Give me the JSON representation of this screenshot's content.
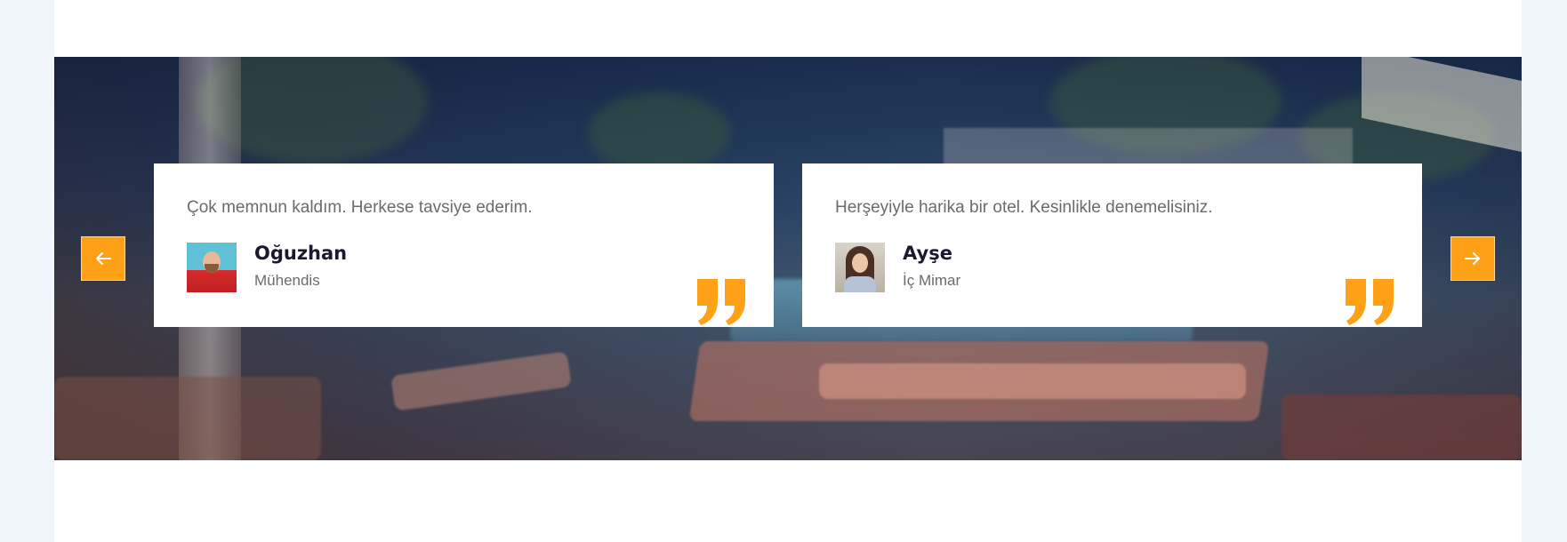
{
  "testimonials": [
    {
      "text": "Çok memnun kaldım. Herkese tavsiye ederim.",
      "name": "Oğuzhan",
      "role": "Mühendis",
      "avatar_icon": "avatar-man-icon"
    },
    {
      "text": "Herşeyiyle harika bir otel. Kesinlikle denemelisiniz.",
      "name": "Ayşe",
      "role": "İç Mimar",
      "avatar_icon": "avatar-woman-icon"
    }
  ],
  "carousel": {
    "prev_icon": "arrow-left-icon",
    "next_icon": "arrow-right-icon"
  },
  "colors": {
    "accent": "#fea116",
    "card_background": "#ffffff",
    "page_background": "#ffffff",
    "side_background": "#f1f6fd",
    "name_text": "#1a1a2e",
    "body_text": "#6b6b6b"
  }
}
